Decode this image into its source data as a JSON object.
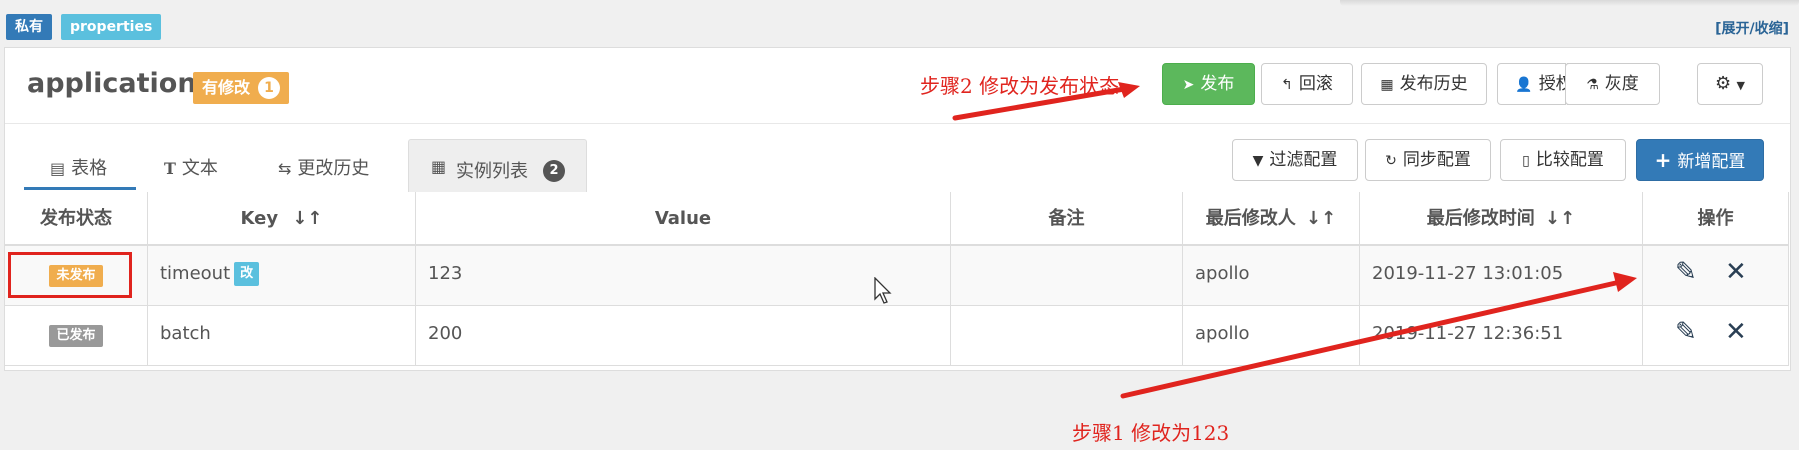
{
  "header": {
    "tag_private": "私有",
    "tag_format": "properties",
    "toggle_label": "[展开/收缩]"
  },
  "namespace": {
    "title": "application",
    "modified_label": "有修改",
    "modified_count": "1"
  },
  "toolbar": {
    "publish": "发布",
    "rollback": "回滚",
    "release_history": "发布历史",
    "authorize": "授权",
    "gray": "灰度"
  },
  "tabs": {
    "table": "表格",
    "text": "文本",
    "history": "更改历史",
    "instances": "实例列表",
    "instances_count": "2"
  },
  "actions": {
    "filter": "过滤配置",
    "sync": "同步配置",
    "compare": "比较配置",
    "add": "新增配置"
  },
  "table": {
    "headers": {
      "status": "发布状态",
      "key": "Key",
      "value": "Value",
      "comment": "备注",
      "modifier": "最后修改人",
      "modified_time": "最后修改时间",
      "ops": "操作"
    },
    "rows": [
      {
        "status": "未发布",
        "key": "timeout",
        "key_tag": "改",
        "value": "123",
        "comment": "",
        "modifier": "apollo",
        "time": "2019-11-27 13:01:05"
      },
      {
        "status": "已发布",
        "key": "batch",
        "key_tag": "",
        "value": "200",
        "comment": "",
        "modifier": "apollo",
        "time": "2019-11-27 12:36:51"
      }
    ]
  },
  "annotations": {
    "step2": "步骤2  修改为发布状态",
    "step1": "步骤1  修改为123"
  },
  "colors": {
    "primary": "#337ab7",
    "success": "#5cb85c",
    "warning": "#f0ad4e",
    "info": "#5bc0de",
    "annotation_red": "#e0241e"
  }
}
